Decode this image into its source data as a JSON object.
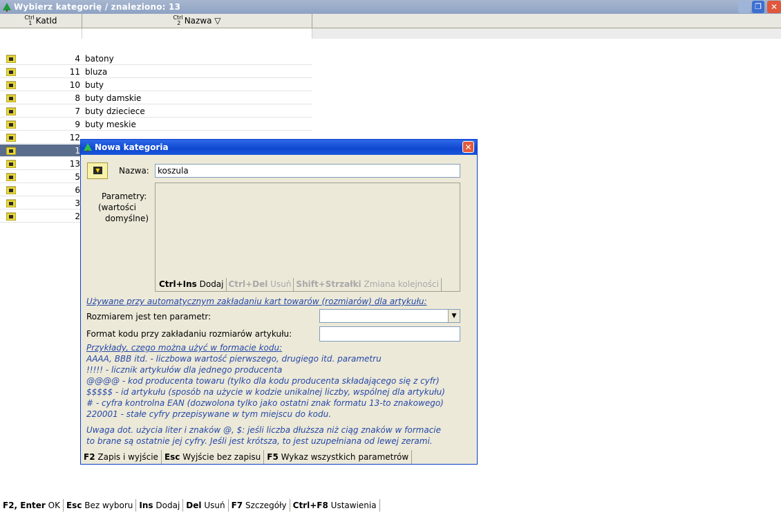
{
  "window": {
    "title": "Wybierz kategorię / znaleziono: 13",
    "colors": {
      "title_bar": "#9aabc9",
      "selected_row": "#5a6d8d",
      "dialog_title": "#1a56dc",
      "hint_text": "#2648a8"
    }
  },
  "grid": {
    "columns": [
      {
        "ctrl": "Ctrl 1",
        "label": "KatId"
      },
      {
        "ctrl": "Ctrl 2",
        "label": "Nazwa ▽"
      }
    ],
    "rows": [
      {
        "id": "4",
        "name": "batony"
      },
      {
        "id": "11",
        "name": "bluza"
      },
      {
        "id": "10",
        "name": "buty"
      },
      {
        "id": "8",
        "name": "buty damskie"
      },
      {
        "id": "7",
        "name": "buty dzieciece"
      },
      {
        "id": "9",
        "name": "buty meskie"
      },
      {
        "id": "12",
        "name": ""
      },
      {
        "id": "1",
        "name": "",
        "selected": true
      },
      {
        "id": "13",
        "name": ""
      },
      {
        "id": "5",
        "name": ""
      },
      {
        "id": "6",
        "name": ""
      },
      {
        "id": "3",
        "name": ""
      },
      {
        "id": "2",
        "name": ""
      }
    ],
    "row_icon": "folder-icon"
  },
  "dialog": {
    "title": "Nowa kategoria",
    "nazwa_label": "Nazwa:",
    "nazwa_value": "koszula",
    "params_label_1": "Parametry:",
    "params_label_2": "(wartości",
    "params_label_3": "domyślne)",
    "toolbar": {
      "add_key": "Ctrl+Ins",
      "add_label": "Dodaj",
      "del_key": "Ctrl+Del",
      "del_label": "Usuń",
      "move_key": "Shift+Strzałki",
      "move_label": "Zmiana kolejności"
    },
    "info_heading": "Używane przy automatycznym zakładaniu kart towarów (rozmiarów) dla artykułu:",
    "size_param_label": "Rozmiarem jest ten parametr:",
    "size_param_value": "",
    "code_format_label": "Format kodu przy zakładaniu rozmiarów artykułu:",
    "code_format_value": "",
    "examples_heading": "Przykłady, czego można użyć w formacie kodu:",
    "examples": [
      "AAAA, BBB itd. - liczbowa wartość pierwszego, drugiego itd. parametru",
      "!!!!! - licznik artykułów dla jednego producenta",
      "@@@@ - kod producenta towaru (tylko dla kodu producenta składającego się z cyfr)",
      "$$$$$ - id artykułu (sposób na użycie w kodzie unikalnej liczby, wspólnej dla artykułu)",
      "# - cyfra kontrolna EAN (dozwolona tylko jako ostatni znak formatu 13-to znakowego)",
      "220001 - stałe cyfry przepisywane w tym miejscu do kodu."
    ],
    "note_1": "Uwaga dot. użycia liter i znaków @, $: jeśli liczba dłuższa niż ciąg znaków w formacie",
    "note_2": "to brane są ostatnie jej cyfry. Jeśli jest krótsza, to jest uzupełniana od lewej zerami.",
    "footer": {
      "save_key": "F2",
      "save_label": "Zapis i wyjście",
      "esc_key": "Esc",
      "esc_label": "Wyjście bez zapisu",
      "list_key": "F5",
      "list_label": "Wykaz wszystkich parametrów"
    }
  },
  "status_bar": {
    "ok_key": "F2, Enter",
    "ok_label": "OK",
    "esc_key": "Esc",
    "esc_label": "Bez wyboru",
    "ins_key": "Ins",
    "ins_label": "Dodaj",
    "del_key": "Del",
    "del_label": "Usuń",
    "f7_key": "F7",
    "f7_label": "Szczegóły",
    "f8_key": "Ctrl+F8",
    "f8_label": "Ustawienia"
  }
}
